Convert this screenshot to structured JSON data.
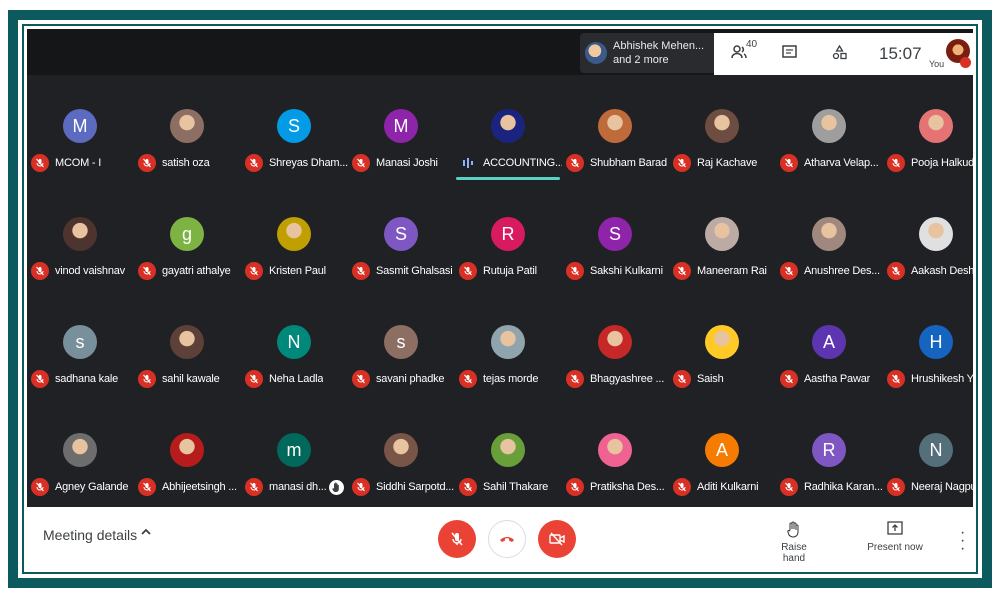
{
  "presenter": {
    "line1": "Abhishek Mehen...",
    "line2": "and 2 more"
  },
  "top_panel": {
    "people_count": "40",
    "time": "15:07",
    "you_label": "You"
  },
  "participants": [
    {
      "name": "MCOM - I",
      "initial": "M",
      "color": "#5c6bc0"
    },
    {
      "name": "satish oza",
      "initial": "",
      "color": "#8d6e63"
    },
    {
      "name": "Shreyas Dham...",
      "initial": "S",
      "color": "#039be5"
    },
    {
      "name": "Manasi Joshi",
      "initial": "M",
      "color": "#8e24aa"
    },
    {
      "name": "ACCOUNTING...",
      "initial": "",
      "color": "#1a237e"
    },
    {
      "name": "Shubham Barad",
      "initial": "",
      "color": "#bf6a3b"
    },
    {
      "name": "Raj Kachave",
      "initial": "",
      "color": "#6d4c41"
    },
    {
      "name": "Atharva Velap...",
      "initial": "",
      "color": "#9e9e9e"
    },
    {
      "name": "Pooja Halkude",
      "initial": "",
      "color": "#e57373"
    },
    {
      "name": "vinod vaishnav",
      "initial": "",
      "color": "#4e342e"
    },
    {
      "name": "gayatri athalye",
      "initial": "g",
      "color": "#7cb342"
    },
    {
      "name": "Kristen Paul",
      "initial": "",
      "color": "#c0a000"
    },
    {
      "name": "Sasmit Ghalsasi",
      "initial": "S",
      "color": "#7e57c2"
    },
    {
      "name": "Rutuja Patil",
      "initial": "R",
      "color": "#d81b60"
    },
    {
      "name": "Sakshi Kulkarni",
      "initial": "S",
      "color": "#8e24aa"
    },
    {
      "name": "Maneeram Rai",
      "initial": "",
      "color": "#bcaaa4"
    },
    {
      "name": "Anushree Des...",
      "initial": "",
      "color": "#a1887f"
    },
    {
      "name": "Aakash Desh...",
      "initial": "",
      "color": "#e0e0e0"
    },
    {
      "name": "sadhana kale",
      "initial": "s",
      "color": "#78909c"
    },
    {
      "name": "sahil kawale",
      "initial": "",
      "color": "#5d4037"
    },
    {
      "name": "Neha Ladla",
      "initial": "N",
      "color": "#00897b"
    },
    {
      "name": "savani phadke",
      "initial": "s",
      "color": "#8d6e63"
    },
    {
      "name": "tejas morde",
      "initial": "",
      "color": "#90a4ae"
    },
    {
      "name": "Bhagyashree ...",
      "initial": "",
      "color": "#c62828"
    },
    {
      "name": "Saish",
      "initial": "",
      "color": "#ffca28"
    },
    {
      "name": "Aastha Pawar",
      "initial": "A",
      "color": "#5e35b1"
    },
    {
      "name": "Hrushikesh Ya...",
      "initial": "H",
      "color": "#1565c0"
    },
    {
      "name": "Agney Galande",
      "initial": "",
      "color": "#6d6d6d"
    },
    {
      "name": "Abhijeetsingh ...",
      "initial": "",
      "color": "#b71c1c"
    },
    {
      "name": "manasi dh...",
      "initial": "m",
      "color": "#00695c"
    },
    {
      "name": "Siddhi Sarpotd...",
      "initial": "",
      "color": "#795548"
    },
    {
      "name": "Sahil Thakare",
      "initial": "",
      "color": "#689f38"
    },
    {
      "name": "Pratiksha Des...",
      "initial": "",
      "color": "#f06292"
    },
    {
      "name": "Aditi Kulkarni",
      "initial": "A",
      "color": "#f57c00"
    },
    {
      "name": "Radhika Karan...",
      "initial": "R",
      "color": "#7e57c2"
    },
    {
      "name": "Neeraj Nagpur...",
      "initial": "N",
      "color": "#546e7a"
    }
  ],
  "speaking_index": 4,
  "hand_raised_index": 29,
  "bottom": {
    "meeting_details": "Meeting details",
    "raise_hand": "Raise hand",
    "present_now": "Present now"
  }
}
